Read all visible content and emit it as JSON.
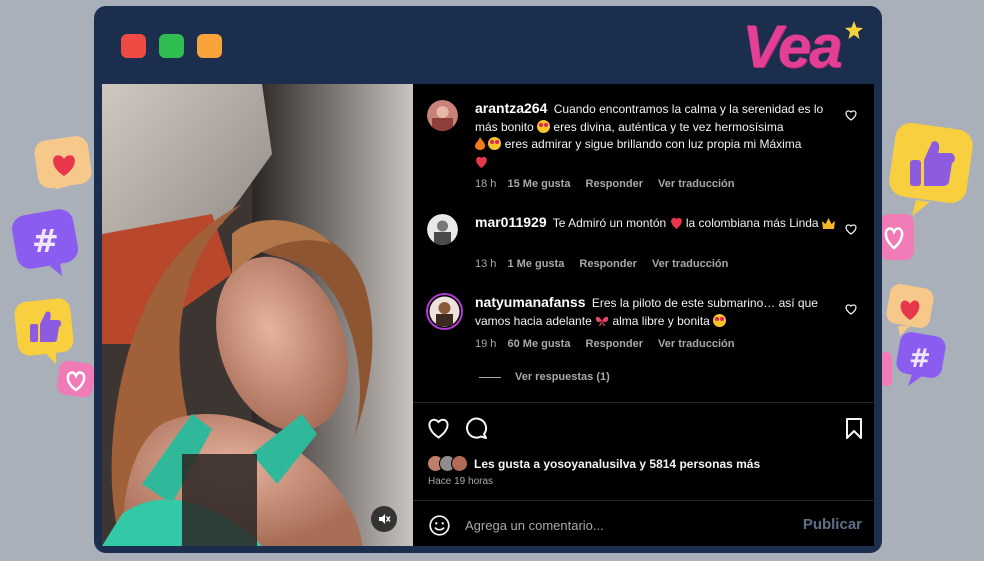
{
  "brand": {
    "logo_text": "Vea"
  },
  "comments": [
    {
      "user": "arantza264",
      "text_parts": [
        "Cuando encontramos la calma y la serenidad es lo más bonito",
        "eres divina, auténtica y te vez hermosísima",
        "eres admirar y sigue brillando con luz propia mi Máxima"
      ],
      "time": "18 h",
      "likes": "15 Me gusta",
      "reply": "Responder",
      "translate": "Ver traducción"
    },
    {
      "user": "mar011929",
      "text_parts": [
        "Te Admiró un montón",
        "la colombiana más Linda"
      ],
      "time": "13 h",
      "likes": "1 Me gusta",
      "reply": "Responder",
      "translate": "Ver traducción"
    },
    {
      "user": "natyumanafanss",
      "text_parts": [
        "Eres la piloto de este submarino… así que vamos hacia adelante",
        "alma libre y bonita"
      ],
      "time": "19 h",
      "likes": "60 Me gusta",
      "reply": "Responder",
      "translate": "Ver traducción"
    }
  ],
  "view_replies": "Ver respuestas (1)",
  "likes_summary": "Les gusta a yosoyanalusilva y 5814 personas más",
  "posted_ago": "Hace 19 horas",
  "comment_input": {
    "placeholder": "Agrega un comentario...",
    "publish_label": "Publicar"
  },
  "colors": {
    "frame": "#1b2e4e",
    "background": "#a9b0b9",
    "brand_pink": "#e33f95",
    "publish": "#5f6f86"
  },
  "icons": [
    "heart-outline-icon",
    "comment-bubble-icon",
    "bookmark-icon",
    "emoji-smile-icon",
    "mute-icon",
    "heart-emoji-icon",
    "thumbs-up-icon",
    "hashtag-icon"
  ]
}
